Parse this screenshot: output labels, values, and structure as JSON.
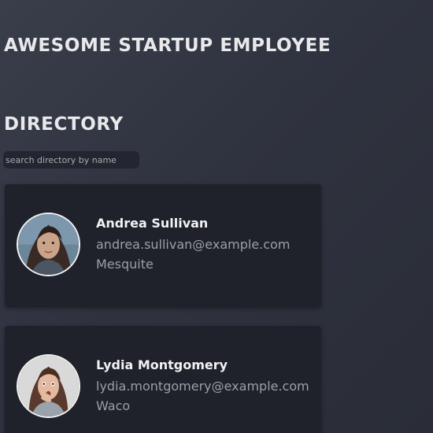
{
  "header": {
    "title_line1": "AWESOME STARTUP EMPLOYEE",
    "title_line2": "DIRECTORY"
  },
  "search": {
    "placeholder": "search directory by name",
    "value": ""
  },
  "employees": [
    {
      "name": "Andrea Sullivan",
      "email": "andrea.sullivan@example.com",
      "city": "Mesquite",
      "avatar_icon": "photo-woman-dark-hair"
    },
    {
      "name": "Lydia Montgomery",
      "email": "lydia.montgomery@example.com",
      "city": "Waco",
      "avatar_icon": "photo-woman-surprised"
    }
  ],
  "colors": {
    "background": "#2f333f",
    "card": "#1f212b",
    "text_primary": "#f2f2f4",
    "text_secondary": "#9d9fa8"
  }
}
